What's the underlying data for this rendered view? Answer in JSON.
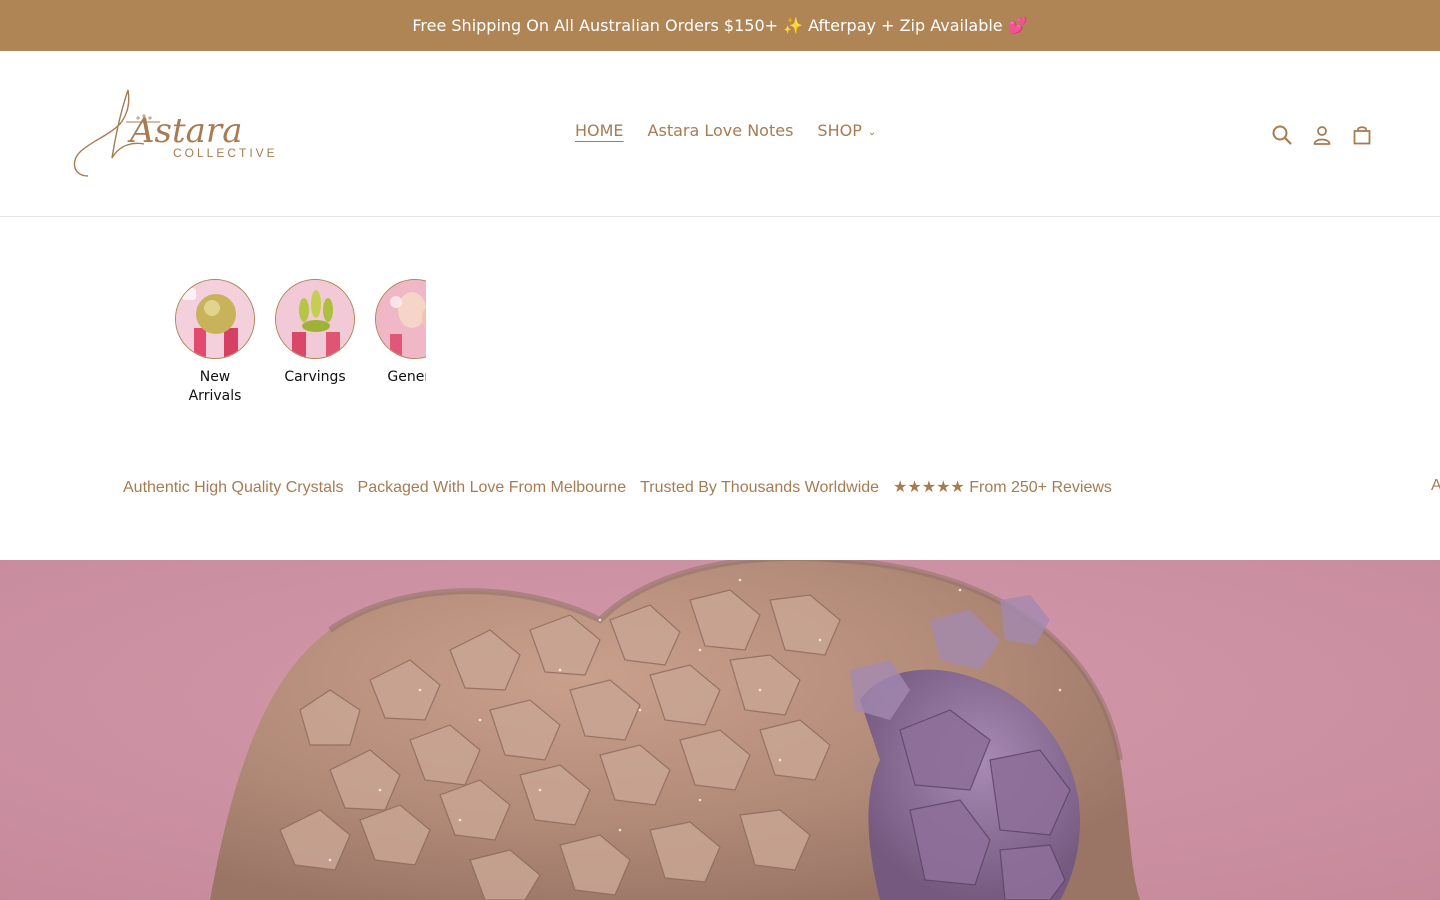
{
  "announcement": {
    "text": "Free Shipping On All Australian Orders $150+ ✨ Afterpay + Zip Available 💕"
  },
  "header": {
    "logo": {
      "script_text": "Astara",
      "sub_text": "COLLECTIVE"
    },
    "nav": [
      {
        "label": "HOME",
        "active": true
      },
      {
        "label": "Astara Love Notes"
      },
      {
        "label": "SHOP",
        "dropdown": true
      }
    ],
    "icons": [
      "search-icon",
      "account-icon",
      "cart-icon"
    ]
  },
  "collections": [
    {
      "label": "New Arrivals"
    },
    {
      "label": "Carvings"
    },
    {
      "label": "General"
    }
  ],
  "marquee": {
    "items": [
      "Authentic High Quality Crystals",
      "Packaged With Love From Melbourne",
      "Trusted By Thousands Worldwide",
      "★★★★★ From 250+ Reviews"
    ],
    "repeat_partial": "A"
  },
  "colors": {
    "brand": "#b08556",
    "text_accent": "#a67c52",
    "hero_background": "#c78e9e"
  }
}
